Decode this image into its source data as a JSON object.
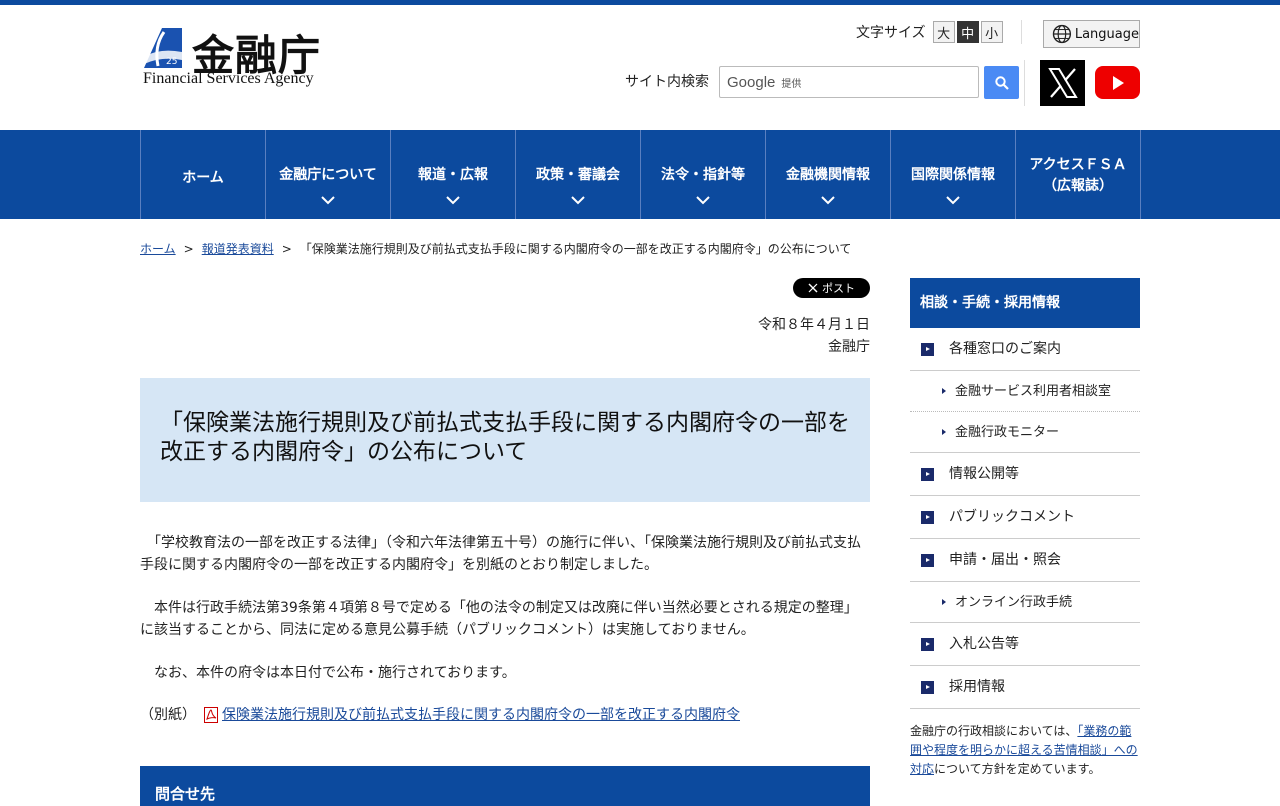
{
  "header": {
    "logo_jp": "金融庁",
    "logo_en": "Financial Services Agency",
    "fontsize_label": "文字サイズ",
    "fontsize_options": [
      "大",
      "中",
      "小"
    ],
    "fontsize_selected": "中",
    "language_label": "Language",
    "search_label": "サイト内検索",
    "search_brand": "Google",
    "search_brand_suffix": "提供"
  },
  "nav": {
    "items": [
      {
        "label": "ホーム"
      },
      {
        "label": "金融庁について"
      },
      {
        "label": "報道・広報"
      },
      {
        "label": "政策・審議会"
      },
      {
        "label": "法令・指針等"
      },
      {
        "label": "金融機関情報"
      },
      {
        "label": "国際関係情報"
      },
      {
        "label_line1": "アクセスＦＳＡ",
        "label_line2": "（広報誌）"
      }
    ]
  },
  "breadcrumb": {
    "home": "ホーム",
    "section": "報道発表資料",
    "current": "「保険業法施行規則及び前払式支払手段に関する内閣府令の一部を改正する内閣府令」の公布について",
    "separator": ">"
  },
  "main": {
    "post_label": "ポスト",
    "date": "令和８年４月１日",
    "issuer": "金融庁",
    "title": "「保険業法施行規則及び前払式支払手段に関する内閣府令の一部を改正する内閣府令」の公布について",
    "paragraph1": "　「学校教育法の一部を改正する法律」（令和六年法律第五十号）の施行に伴い、「保険業法施行規則及び前払式支払手段に関する内閣府令の一部を改正する内閣府令」を別紙のとおり制定しました。",
    "paragraph2": "　本件は行政手続法第39条第４項第８号で定める「他の法令の制定又は改廃に伴い当然必要とされる規定の整理」に該当することから、同法に定める意見公募手続（パブリックコメント）は実施しておりません。",
    "paragraph3": "　なお、本件の府令は本日付で公布・施行されております。",
    "attachment_label": "（別紙）",
    "attachment_link": "保険業法施行規則及び前払式支払手段に関する内閣府令の一部を改正する内閣府令",
    "contact_heading": "問合せ先"
  },
  "sidebar": {
    "heading": "相談・手続・採用情報",
    "items": [
      {
        "label": "各種窓口のご案内",
        "level": "main"
      },
      {
        "label": "金融サービス利用者相談室",
        "level": "sub"
      },
      {
        "label": "金融行政モニター",
        "level": "sub"
      },
      {
        "label": "情報公開等",
        "level": "main"
      },
      {
        "label": "パブリックコメント",
        "level": "main"
      },
      {
        "label": "申請・届出・照会",
        "level": "main"
      },
      {
        "label": "オンライン行政手続",
        "level": "sub"
      },
      {
        "label": "入札公告等",
        "level": "main"
      },
      {
        "label": "採用情報",
        "level": "main"
      }
    ],
    "note_prefix": "金融庁の行政相談においては、",
    "note_link": "「業務の範囲や程度を明らかに超える苦情相談」への対応",
    "note_suffix": "について方針を定めています。"
  },
  "colors": {
    "brand_blue": "#0c4a9e",
    "title_bg": "#d6e6f5",
    "link": "#1a4a9a"
  }
}
